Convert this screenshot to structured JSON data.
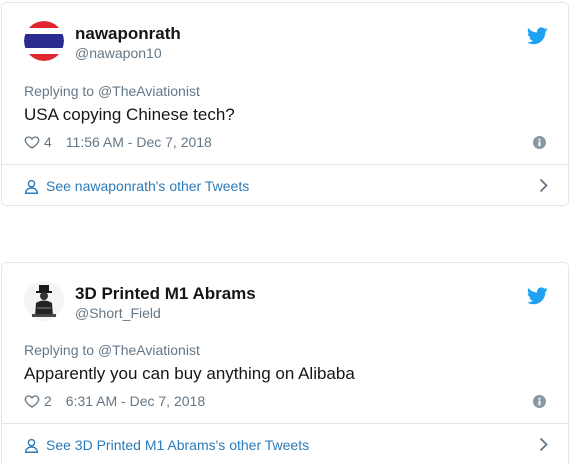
{
  "tweets": [
    {
      "display_name": "nawaponrath",
      "handle": "@nawapon10",
      "reply_prefix": "Replying to ",
      "reply_to": "@TheAviationist",
      "text": "USA copying Chinese tech?",
      "likes": "4",
      "timestamp": "11:56 AM - Dec 7, 2018",
      "footer_link": "See nawaponrath's other Tweets",
      "avatar": "thailand-flag"
    },
    {
      "display_name": "3D Printed M1 Abrams",
      "handle": "@Short_Field",
      "reply_prefix": "Replying to ",
      "reply_to": "@TheAviationist",
      "text": "Apparently you can buy anything on Alibaba",
      "likes": "2",
      "timestamp": "6:31 AM - Dec 7, 2018",
      "footer_link": "See 3D Printed M1 Abrams's other Tweets",
      "avatar": "person-silhouette"
    }
  ],
  "colors": {
    "twitter_blue": "#1da1f2",
    "link_blue": "#2b7bb9",
    "text": "#14171a",
    "muted": "#657786",
    "border": "#e1e8ed"
  },
  "icons": {
    "bird": "twitter-bird-icon",
    "heart": "heart-icon",
    "info": "info-icon",
    "person": "person-icon",
    "chevron": "chevron-right-icon"
  }
}
